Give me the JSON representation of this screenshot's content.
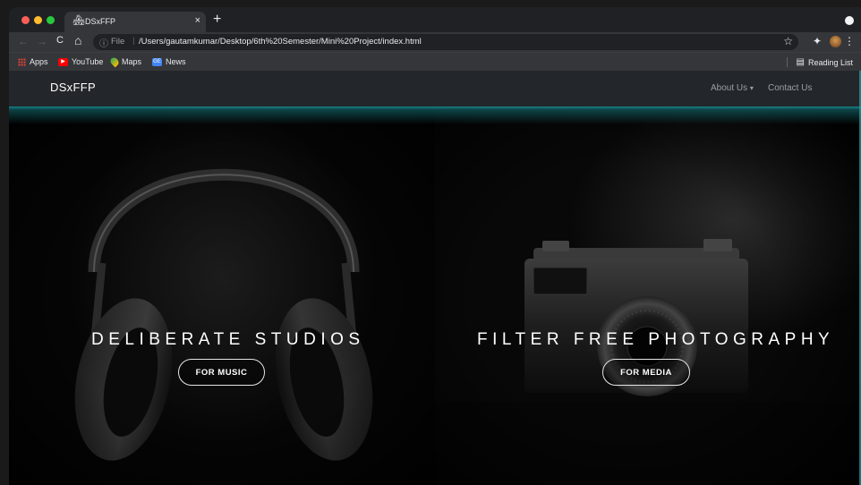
{
  "browser": {
    "tab": {
      "title": "DSxFFP",
      "favicon": "🏘",
      "close": "×"
    },
    "new_tab": "+",
    "nav": {
      "back": "←",
      "forward": "→",
      "reload": "C",
      "home": "⌂"
    },
    "address": {
      "info_icon": "ⓘ",
      "scheme": "File",
      "separator": "|",
      "url": "/Users/gautamkumar/Desktop/6th%20Semester/Mini%20Project/index.html",
      "star": "☆"
    },
    "toolbar_right": {
      "extensions": "✦",
      "menu": "⋮"
    },
    "bookmarks": [
      {
        "label": "Apps",
        "icon": "apps-grid-icon"
      },
      {
        "label": "YouTube",
        "icon": "youtube-icon"
      },
      {
        "label": "Maps",
        "icon": "maps-pin-icon"
      },
      {
        "label": "News",
        "icon": "google-news-icon"
      }
    ],
    "reading_list": "Reading List",
    "reading_list_icon": "▤"
  },
  "site": {
    "brand": "DSxFFP",
    "nav": [
      {
        "label": "About Us",
        "caret": "▾"
      },
      {
        "label": "Contact Us"
      }
    ],
    "accent": "#1ea7ab",
    "heroes": [
      {
        "title": "DELIBERATE STUDIOS",
        "button": "FOR MUSIC",
        "image": "headphones-image"
      },
      {
        "title": "FILTER FREE PHOTOGRAPHY",
        "button": "FOR MEDIA",
        "image": "camera-image"
      }
    ]
  }
}
